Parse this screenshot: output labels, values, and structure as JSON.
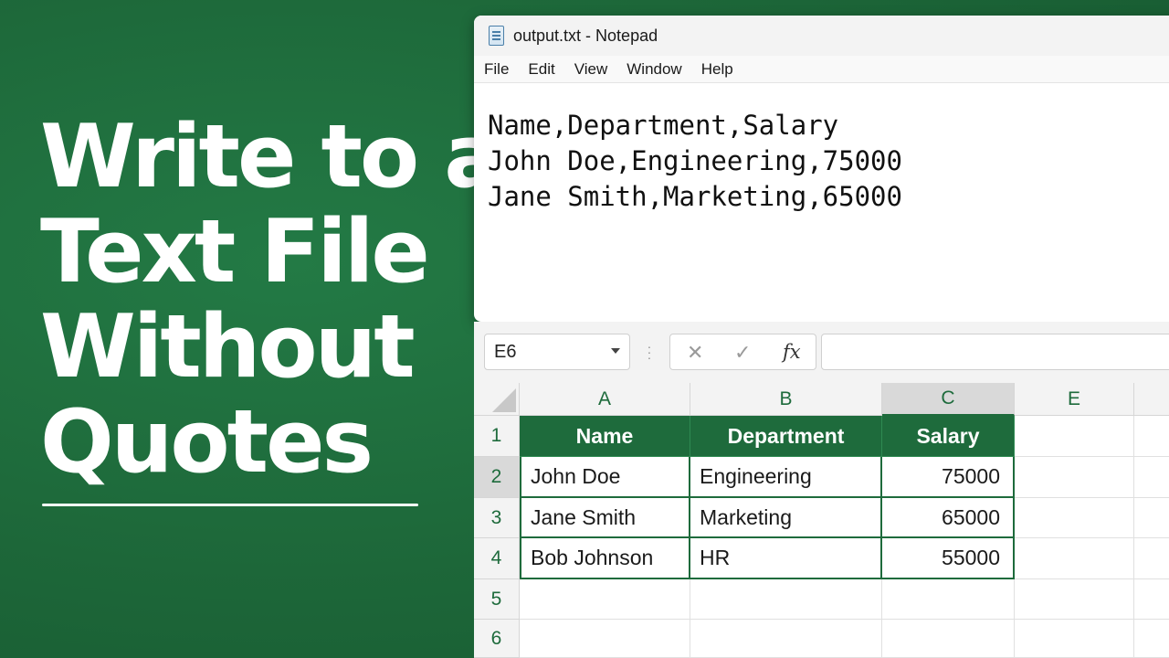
{
  "headline": {
    "lines": [
      "Write to a",
      "Text File",
      "Without",
      "Quotes"
    ]
  },
  "notepad": {
    "title": "output.txt - Notepad",
    "menu": [
      "File",
      "Edit",
      "View",
      "Window",
      "Help"
    ],
    "lines": [
      "Name,Department,Salary",
      "John Doe,Engineering,75000",
      "Jane Smith,Marketing,65000"
    ]
  },
  "excel": {
    "name_box": "E6",
    "formula_buttons": {
      "cancel": "✕",
      "enter": "✓",
      "function": "fx"
    },
    "formula_value": "",
    "columns": [
      "A",
      "B",
      "C",
      "E"
    ],
    "selected_column": "C",
    "rows": [
      "1",
      "2",
      "3",
      "4",
      "5",
      "6"
    ],
    "active_row": "2",
    "header": [
      "Name",
      "Department",
      "Salary"
    ],
    "data": [
      [
        "John Doe",
        "Engineering",
        "75000"
      ],
      [
        "Jane Smith",
        "Marketing",
        "65000"
      ],
      [
        "Bob Johnson",
        "HR",
        "55000"
      ]
    ]
  },
  "colors": {
    "brand_green": "#1e6b3c",
    "background_green": "#1d6739",
    "header_text": "#ffffff"
  }
}
